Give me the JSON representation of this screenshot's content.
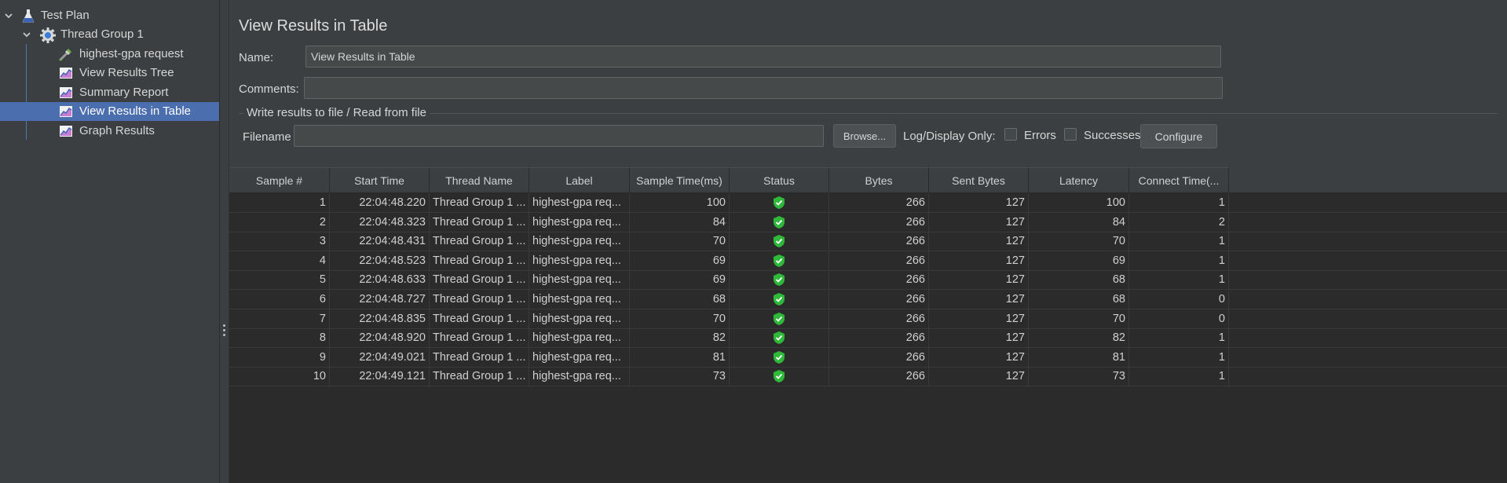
{
  "tree": {
    "items": [
      {
        "label": "Test Plan",
        "icon": "flask-icon",
        "expanded": true,
        "level": 0
      },
      {
        "label": "Thread Group 1",
        "icon": "gear-icon",
        "expanded": true,
        "level": 1
      },
      {
        "label": "highest-gpa request",
        "icon": "pipette-icon",
        "level": 2
      },
      {
        "label": "View Results Tree",
        "icon": "graph-icon",
        "level": 2
      },
      {
        "label": "Summary Report",
        "icon": "graph-icon",
        "level": 2
      },
      {
        "label": "View Results in Table",
        "icon": "graph-icon",
        "level": 2,
        "selected": true
      },
      {
        "label": "Graph Results",
        "icon": "graph-icon",
        "level": 2
      }
    ]
  },
  "panel": {
    "title": "View Results in Table",
    "name_label": "Name:",
    "name_value": "View Results in Table",
    "comments_label": "Comments:",
    "comments_value": "",
    "group_title": "Write results to file / Read from file",
    "filename_label": "Filename",
    "filename_value": "",
    "browse_label": "Browse...",
    "log_display_label": "Log/Display Only:",
    "errors_label": "Errors",
    "successes_label": "Successes",
    "configure_label": "Configure"
  },
  "table": {
    "columns": [
      "Sample #",
      "Start Time",
      "Thread Name",
      "Label",
      "Sample Time(ms)",
      "Status",
      "Bytes",
      "Sent Bytes",
      "Latency",
      "Connect Time(..."
    ],
    "rows": [
      [
        "1",
        "22:04:48.220",
        "Thread Group 1 ...",
        "highest-gpa req...",
        "100",
        "success",
        "266",
        "127",
        "100",
        "1"
      ],
      [
        "2",
        "22:04:48.323",
        "Thread Group 1 ...",
        "highest-gpa req...",
        "84",
        "success",
        "266",
        "127",
        "84",
        "2"
      ],
      [
        "3",
        "22:04:48.431",
        "Thread Group 1 ...",
        "highest-gpa req...",
        "70",
        "success",
        "266",
        "127",
        "70",
        "1"
      ],
      [
        "4",
        "22:04:48.523",
        "Thread Group 1 ...",
        "highest-gpa req...",
        "69",
        "success",
        "266",
        "127",
        "69",
        "1"
      ],
      [
        "5",
        "22:04:48.633",
        "Thread Group 1 ...",
        "highest-gpa req...",
        "69",
        "success",
        "266",
        "127",
        "68",
        "1"
      ],
      [
        "6",
        "22:04:48.727",
        "Thread Group 1 ...",
        "highest-gpa req...",
        "68",
        "success",
        "266",
        "127",
        "68",
        "0"
      ],
      [
        "7",
        "22:04:48.835",
        "Thread Group 1 ...",
        "highest-gpa req...",
        "70",
        "success",
        "266",
        "127",
        "70",
        "0"
      ],
      [
        "8",
        "22:04:48.920",
        "Thread Group 1 ...",
        "highest-gpa req...",
        "82",
        "success",
        "266",
        "127",
        "82",
        "1"
      ],
      [
        "9",
        "22:04:49.021",
        "Thread Group 1 ...",
        "highest-gpa req...",
        "81",
        "success",
        "266",
        "127",
        "81",
        "1"
      ],
      [
        "10",
        "22:04:49.121",
        "Thread Group 1 ...",
        "highest-gpa req...",
        "73",
        "success",
        "266",
        "127",
        "73",
        "1"
      ]
    ]
  },
  "colors": {
    "selection": "#4b6eaf",
    "success_shield": "#2fb83a"
  }
}
